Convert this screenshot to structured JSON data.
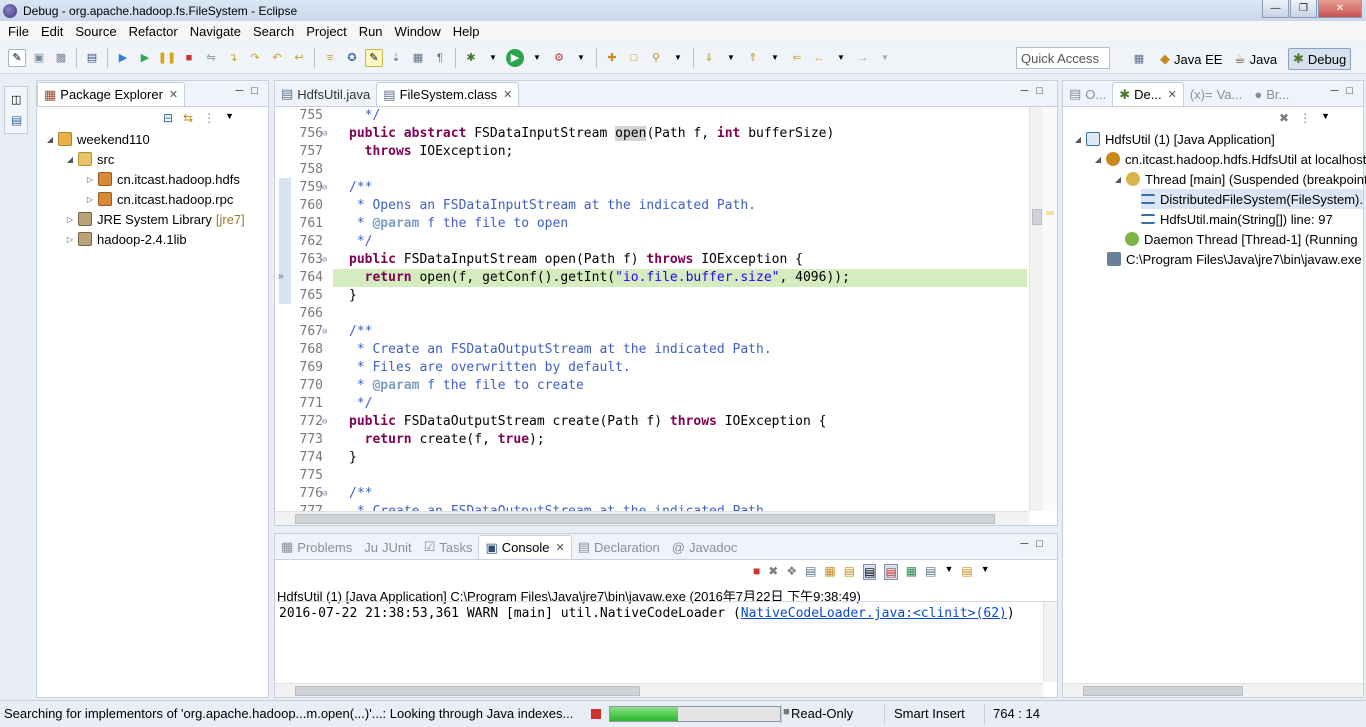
{
  "window": {
    "title": "Debug - org.apache.hadoop.fs.FileSystem - Eclipse"
  },
  "menu": [
    "File",
    "Edit",
    "Source",
    "Refactor",
    "Navigate",
    "Search",
    "Project",
    "Run",
    "Window",
    "Help"
  ],
  "toolbar": {
    "quick_access_placeholder": "Quick Access",
    "perspectives": [
      "Java EE",
      "Java",
      "Debug"
    ],
    "active_perspective": "Debug"
  },
  "package_explorer": {
    "tab": "Package Explorer",
    "tree": [
      {
        "label": "weekend110",
        "icon": "project-icon",
        "expanded": true
      },
      {
        "label": "src",
        "icon": "source-folder-icon",
        "expanded": true
      },
      {
        "label": "cn.itcast.hadoop.hdfs",
        "icon": "package-icon",
        "expanded": false
      },
      {
        "label": "cn.itcast.hadoop.rpc",
        "icon": "package-icon",
        "expanded": false
      },
      {
        "label": "JRE System Library",
        "suffix": "[jre7]",
        "icon": "library-icon",
        "expanded": false
      },
      {
        "label": "hadoop-2.4.1lib",
        "icon": "library-icon",
        "expanded": false
      }
    ]
  },
  "editor": {
    "tabs": [
      {
        "label": "HdfsUtil.java",
        "active": false
      },
      {
        "label": "FileSystem.class",
        "active": true
      }
    ],
    "current_line": 764,
    "lines": [
      {
        "n": "755",
        "text": "   */"
      },
      {
        "n": "756",
        "text": "  public abstract FSDataInputStream open(Path f, int bufferSize)"
      },
      {
        "n": "757",
        "text": "    throws IOException;"
      },
      {
        "n": "758",
        "text": ""
      },
      {
        "n": "759",
        "text": "  /**"
      },
      {
        "n": "760",
        "text": "   * Opens an FSDataInputStream at the indicated Path."
      },
      {
        "n": "761",
        "text": "   * @param f the file to open"
      },
      {
        "n": "762",
        "text": "   */"
      },
      {
        "n": "763",
        "text": "  public FSDataInputStream open(Path f) throws IOException {"
      },
      {
        "n": "764",
        "text": "    return open(f, getConf().getInt(\"io.file.buffer.size\", 4096));"
      },
      {
        "n": "765",
        "text": "  }"
      },
      {
        "n": "766",
        "text": ""
      },
      {
        "n": "767",
        "text": "  /**"
      },
      {
        "n": "768",
        "text": "   * Create an FSDataOutputStream at the indicated Path."
      },
      {
        "n": "769",
        "text": "   * Files are overwritten by default."
      },
      {
        "n": "770",
        "text": "   * @param f the file to create"
      },
      {
        "n": "771",
        "text": "   */"
      },
      {
        "n": "772",
        "text": "  public FSDataOutputStream create(Path f) throws IOException {"
      },
      {
        "n": "773",
        "text": "    return create(f, true);"
      },
      {
        "n": "774",
        "text": "  }"
      },
      {
        "n": "775",
        "text": ""
      },
      {
        "n": "776",
        "text": "  /**"
      },
      {
        "n": "777",
        "text": "   * Create an FSDataOutputStream at the indicated Path."
      }
    ]
  },
  "bottom_panel": {
    "tabs": [
      "Problems",
      "JUnit",
      "Tasks",
      "Console",
      "Declaration",
      "Javadoc"
    ],
    "active_tab": "Console",
    "console_header": "HdfsUtil (1) [Java Application] C:\\Program Files\\Java\\jre7\\bin\\javaw.exe (2016年7月22日 下午9:38:49)",
    "console_line_text": "2016-07-22 21:38:53,361 WARN  [main] util.NativeCodeLoader (",
    "console_link": "NativeCodeLoader.java:<clinit>(62)",
    "console_line_end": ")"
  },
  "right_panel": {
    "tabs": [
      "O...",
      "De...",
      "Va...",
      "Br..."
    ],
    "active_tab": "De...",
    "tree": [
      {
        "label": "HdfsUtil (1) [Java Application]",
        "icon": "java-app-icon"
      },
      {
        "label": "cn.itcast.hadoop.hdfs.HdfsUtil at localhost",
        "icon": "vm-icon"
      },
      {
        "label": "Thread [main] (Suspended (breakpoint",
        "icon": "thread-icon"
      },
      {
        "label": "DistributedFileSystem(FileSystem).",
        "icon": "stack-frame-icon",
        "selected": true
      },
      {
        "label": "HdfsUtil.main(String[]) line: 97",
        "icon": "stack-frame-icon"
      },
      {
        "label": "Daemon Thread [Thread-1] (Running",
        "icon": "thread-icon"
      },
      {
        "label": "C:\\Program Files\\Java\\jre7\\bin\\javaw.exe",
        "icon": "process-icon"
      }
    ]
  },
  "status": {
    "message": "Searching for implementors of 'org.apache.hadoop...m.open(...)'...: Looking through Java indexes...",
    "progress": 0.4,
    "read_only": "Read-Only",
    "insert_mode": "Smart Insert",
    "position": "764 : 14"
  }
}
